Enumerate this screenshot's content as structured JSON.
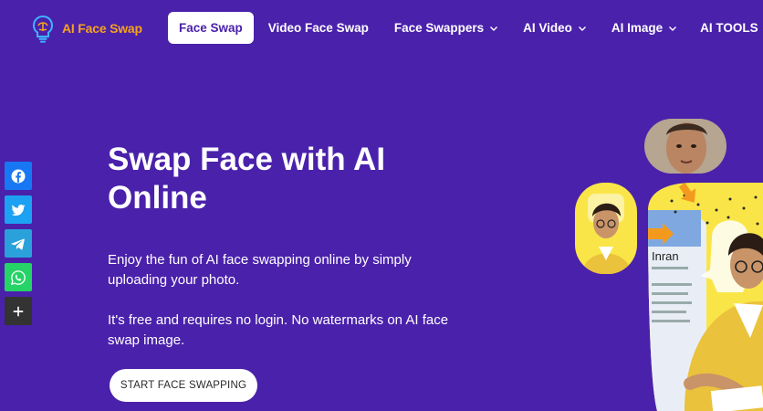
{
  "brand": {
    "name": "AI Face Swap"
  },
  "nav": {
    "items": [
      {
        "label": "Face Swap",
        "active": true,
        "dropdown": false
      },
      {
        "label": "Video Face Swap",
        "active": false,
        "dropdown": false
      },
      {
        "label": "Face Swappers",
        "active": false,
        "dropdown": true
      },
      {
        "label": "AI Video",
        "active": false,
        "dropdown": true
      },
      {
        "label": "AI Image",
        "active": false,
        "dropdown": true
      },
      {
        "label": "AI TOOLS",
        "active": false,
        "dropdown": true
      }
    ]
  },
  "share": {
    "buttons": [
      {
        "icon": "facebook-icon",
        "color": "#1877f2"
      },
      {
        "icon": "twitter-icon",
        "color": "#1da1f2"
      },
      {
        "icon": "telegram-icon",
        "color": "#2aa1db"
      },
      {
        "icon": "whatsapp-icon",
        "color": "#25d366"
      },
      {
        "icon": "plus-icon",
        "color": "#333333"
      }
    ]
  },
  "hero": {
    "title": "Swap Face with AI Online",
    "paragraph1": "Enjoy the fun of AI face swapping online by simply uploading your photo.",
    "paragraph2": "It's free and requires no login. No watermarks on AI face swap image.",
    "cta_label": "START FACE SWAPPING"
  },
  "illustration": {
    "card_name": "Inran"
  },
  "colors": {
    "background": "#4a21ab",
    "brand_orange": "#f7a21b",
    "snap_yellow": "#f9e547",
    "arrow_orange": "#f39a1e"
  }
}
